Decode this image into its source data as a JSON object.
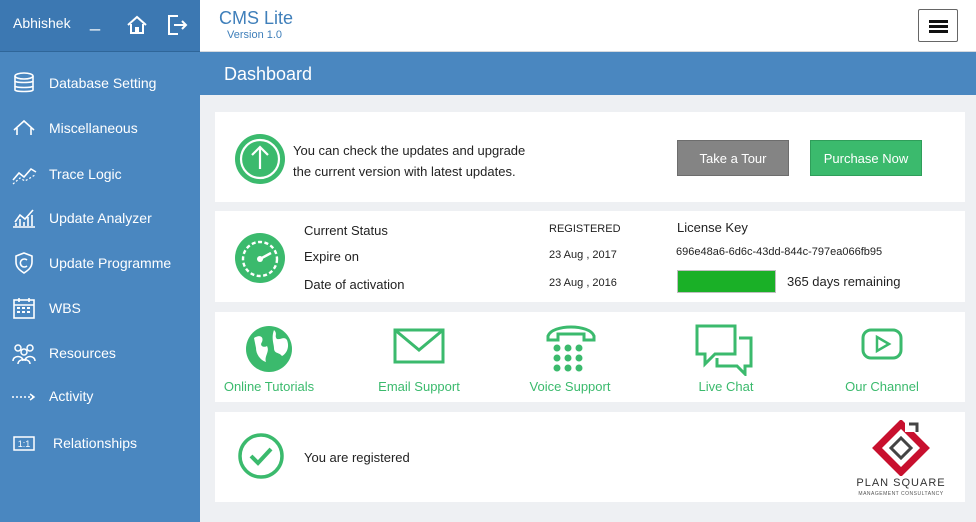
{
  "user": {
    "name": "Abhishek"
  },
  "header": {
    "title": "CMS Lite",
    "version": "Version 1.0"
  },
  "banner": {
    "title": "Dashboard"
  },
  "sidebar": {
    "items": [
      {
        "label": "Database Setting",
        "icon": "database-icon"
      },
      {
        "label": "Miscellaneous",
        "icon": "house-outline-icon"
      },
      {
        "label": "Trace Logic",
        "icon": "trace-chart-icon"
      },
      {
        "label": "Update Analyzer",
        "icon": "analyzer-chart-icon"
      },
      {
        "label": "Update Programme",
        "icon": "shield-icon"
      },
      {
        "label": "WBS",
        "icon": "wbs-calendar-icon"
      },
      {
        "label": "Resources",
        "icon": "people-icon"
      },
      {
        "label": "Activity",
        "icon": "dotted-arrow-icon"
      },
      {
        "label": "Relationships",
        "icon": "one-to-one-icon"
      }
    ]
  },
  "update": {
    "line1": "You can check the updates and upgrade",
    "line2": "the current version with latest updates.",
    "tour_label": "Take a Tour",
    "buy_label": "Purchase Now"
  },
  "status": {
    "current_status_label": "Current Status",
    "current_status_value": "REGISTERED",
    "expire_label": "Expire on",
    "expire_value": "23 Aug , 2017",
    "activation_label": "Date of activation",
    "activation_value": "23 Aug , 2016",
    "license_title": "License Key",
    "license_key": "696e48a6-6d6c-43dd-844c-797ea066fb95",
    "progress_fraction": 1.0,
    "remaining": "365 days remaining"
  },
  "support": [
    {
      "label": "Online Tutorials",
      "icon": "globe-icon"
    },
    {
      "label": "Email Support",
      "icon": "envelope-icon"
    },
    {
      "label": "Voice Support",
      "icon": "telephone-icon"
    },
    {
      "label": "Live Chat",
      "icon": "chat-bubbles-icon"
    },
    {
      "label": "Our Channel",
      "icon": "video-play-icon"
    }
  ],
  "registration": {
    "message": "You are registered"
  },
  "brand": {
    "name": "PLAN SQUARE",
    "tagline": "MANAGEMENT CONSULTANCY"
  },
  "colors": {
    "accent_blue": "#4a87c0",
    "green": "#3bba6d",
    "progress_green": "#1ab027",
    "gray_button": "#848484"
  }
}
